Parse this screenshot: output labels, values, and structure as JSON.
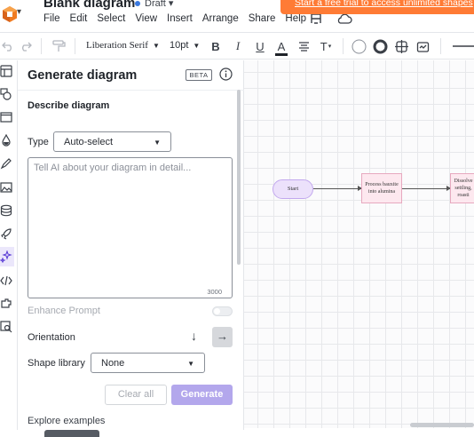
{
  "app": {
    "doc_title": "Blank diagram",
    "status": "Draft",
    "trial_banner": "Start a free trial to access unlimited shapes"
  },
  "menu": [
    "File",
    "Edit",
    "Select",
    "View",
    "Insert",
    "Arrange",
    "Share",
    "Help"
  ],
  "toolbar": {
    "font": "Liberation Serif",
    "font_size": "10pt",
    "bold": "B",
    "italic": "I",
    "underline": "U",
    "text_color": "A",
    "text_options": "T"
  },
  "panel": {
    "title": "Generate diagram",
    "badge": "BETA",
    "section": "Describe diagram",
    "type_label": "Type",
    "type_value": "Auto-select",
    "prompt_placeholder": "Tell AI about your diagram in detail...",
    "char_limit": "3000",
    "enhance_label": "Enhance Prompt",
    "orientation_label": "Orientation",
    "shape_library_label": "Shape library",
    "shape_library_value": "None",
    "clear_label": "Clear all",
    "generate_label": "Generate",
    "explore_label": "Explore examples"
  },
  "diagram": {
    "start": "Start",
    "step1": "Process bauxite into alumina",
    "step2": "Dissolve settling, roasti"
  },
  "colors": {
    "accent": "#b3a7ec",
    "banner": "#ff7b35",
    "start_fill": "#ece1fb",
    "process_fill": "#fde8ef"
  },
  "icons": {
    "rail": [
      "shapes-panel-icon",
      "shape-library-icon",
      "frame-icon",
      "fill-icon",
      "pen-icon",
      "image-icon",
      "data-icon",
      "rocket-icon",
      "ai-sparkle-icon",
      "code-icon",
      "integration-icon",
      "find-icon"
    ]
  }
}
